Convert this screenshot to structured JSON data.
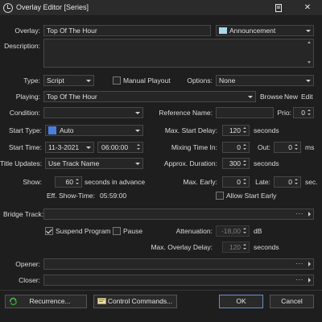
{
  "window": {
    "title": "Overlay Editor [Series]",
    "edit_icon": "edit-icon",
    "close_glyph": "✕"
  },
  "overlay": {
    "label": "Overlay:",
    "value": "Top Of  The Hour",
    "category": "Announcement",
    "category_color": "#a9d7ee"
  },
  "description": {
    "label": "Description:",
    "value": ""
  },
  "type": {
    "label": "Type:",
    "value": "Script"
  },
  "manual_playout": {
    "label": "Manual Playout",
    "checked": false
  },
  "options": {
    "label": "Options:",
    "value": "None"
  },
  "playing": {
    "label": "Playing:",
    "value": "Top Of The Hour",
    "browse": "Browse",
    "new": "New",
    "edit": "Edit"
  },
  "condition": {
    "label": "Condition:",
    "value": ""
  },
  "reference_name": {
    "label": "Reference Name:",
    "value": ""
  },
  "prio": {
    "label": "Prio:",
    "value": "0"
  },
  "start_type": {
    "label": "Start Type:",
    "value": "Auto",
    "color": "#4a7fe0"
  },
  "max_start_delay": {
    "label": "Max. Start Delay:",
    "value": "120",
    "unit": "seconds"
  },
  "start_time": {
    "label": "Start Time:",
    "date": "11-3-2021",
    "time": "06:00:00"
  },
  "mixing_time_in": {
    "label": "Mixing Time In:",
    "value": "0"
  },
  "out": {
    "label": "Out:",
    "value": "0",
    "unit": "ms"
  },
  "title_updates": {
    "label": "Title Updates:",
    "value": "Use Track Name"
  },
  "approx_duration": {
    "label": "Approx. Duration:",
    "value": "300",
    "unit": "seconds"
  },
  "show": {
    "label": "Show:",
    "value": "60",
    "unit": "seconds in advance"
  },
  "max_early": {
    "label": "Max. Early:",
    "value": "0"
  },
  "late": {
    "label": "Late:",
    "value": "0",
    "unit": "sec."
  },
  "eff_show_time": {
    "label": "Eff. Show-Time:",
    "value": "05:59:00"
  },
  "allow_start_early": {
    "label": "Allow Start Early",
    "checked": false
  },
  "bridge_track": {
    "label": "Bridge Track:",
    "value": "",
    "dots": "···"
  },
  "suspend_program": {
    "label": "Suspend Program",
    "checked": true
  },
  "pause": {
    "label": "Pause",
    "checked": false
  },
  "attenuation": {
    "label": "Attenuation:",
    "value": "-18,00",
    "unit": "dB"
  },
  "max_overlay_delay": {
    "label": "Max. Overlay Delay:",
    "value": "120",
    "unit": "seconds"
  },
  "opener": {
    "label": "Opener:",
    "value": "",
    "dots": "···"
  },
  "closer": {
    "label": "Closer:",
    "value": "",
    "dots": "···"
  },
  "buttons": {
    "recurrence": "Recurrence...",
    "control_commands": "Control Commands...",
    "ok": "OK",
    "cancel": "Cancel"
  }
}
